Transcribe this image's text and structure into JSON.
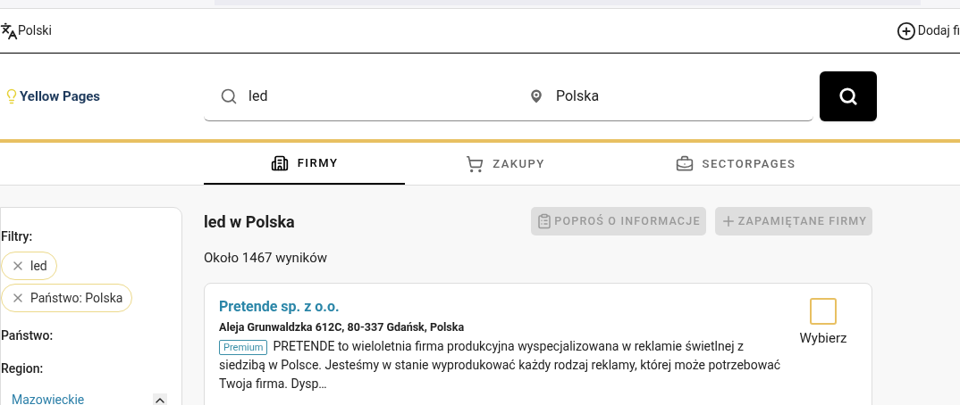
{
  "topbar": {
    "language": "Polski",
    "add_company": "Dodaj fi"
  },
  "header": {
    "logo": "Yellow Pages",
    "search": {
      "value": "led"
    },
    "location": {
      "value": "Polska"
    }
  },
  "tabs": [
    {
      "label": "FIRMY",
      "selected": true
    },
    {
      "label": "ZAKUPY",
      "selected": false
    },
    {
      "label": "SECTORPAGES",
      "selected": false
    }
  ],
  "sidebar": {
    "filters_label": "Filtry:",
    "chips": [
      "led",
      "Państwo: Polska"
    ],
    "sections": [
      {
        "label": "Państwo:"
      },
      {
        "label": "Region:",
        "items": [
          "Mazowieckie"
        ]
      }
    ]
  },
  "results": {
    "title": "led w Polska",
    "count": "Około 1467 wyników",
    "actions": [
      {
        "label": "POPROŚ O INFORMACJE",
        "disabled": true
      },
      {
        "label": "ZAPAMIĘTANE FIRMY",
        "disabled": true
      }
    ],
    "companies": [
      {
        "name": "Pretende sp. z o.o.",
        "address": "Aleja Grunwaldzka 612C, 80-337 Gdańsk, Polska",
        "badge": "Premium",
        "description": "PRETENDE to wieloletnia firma produkcyjna wyspecjalizowana w reklamie świetlnej z siedzibą w Polsce. Jesteśmy w stanie wyprodukować każdy rodzaj reklamy, której może potrzebować Twoja firma. Dysp…",
        "select_label": "Wybierz",
        "checked": false
      }
    ]
  }
}
